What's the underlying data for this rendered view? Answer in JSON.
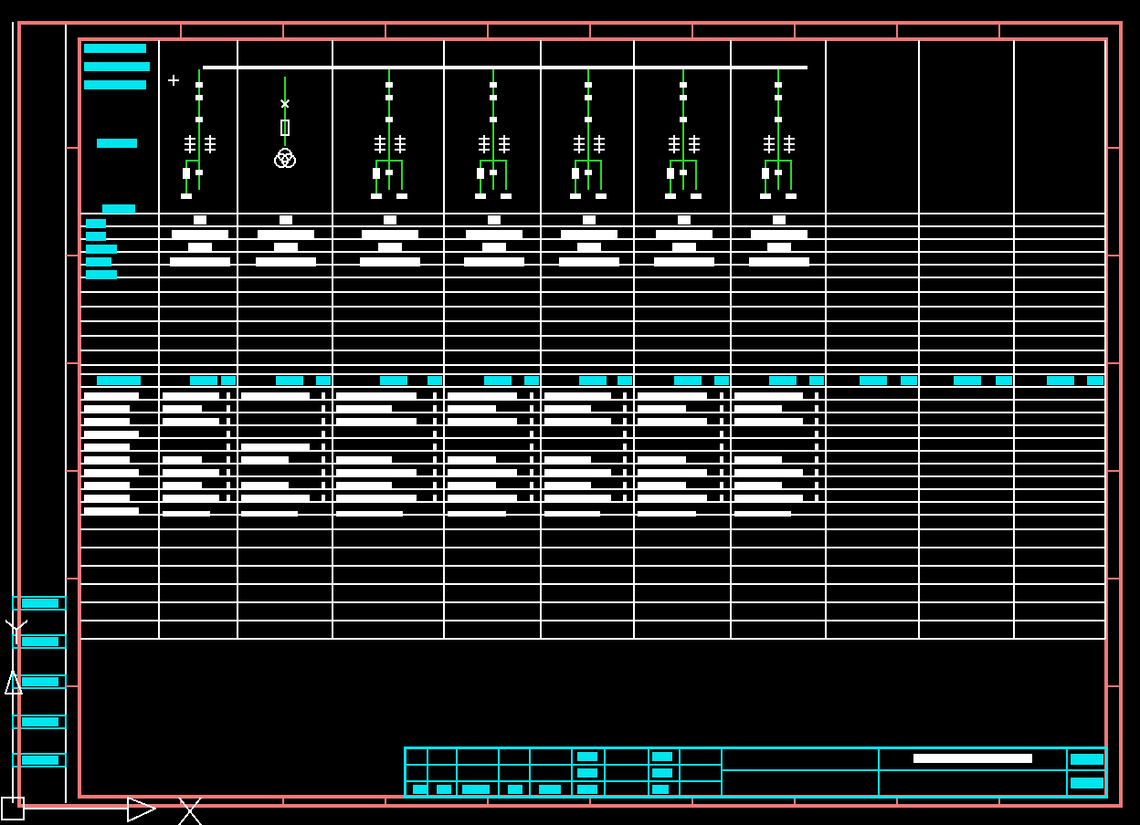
{
  "feeders": [
    {
      "kind": "incoming"
    },
    {
      "kind": "pt"
    },
    {
      "kind": "outgoing"
    },
    {
      "kind": "outgoing"
    },
    {
      "kind": "outgoing"
    },
    {
      "kind": "outgoing"
    },
    {
      "kind": "outgoing"
    }
  ],
  "spare_columns": [
    {
      "kind": "spare"
    },
    {
      "kind": "spare"
    },
    {
      "kind": "spare"
    }
  ]
}
